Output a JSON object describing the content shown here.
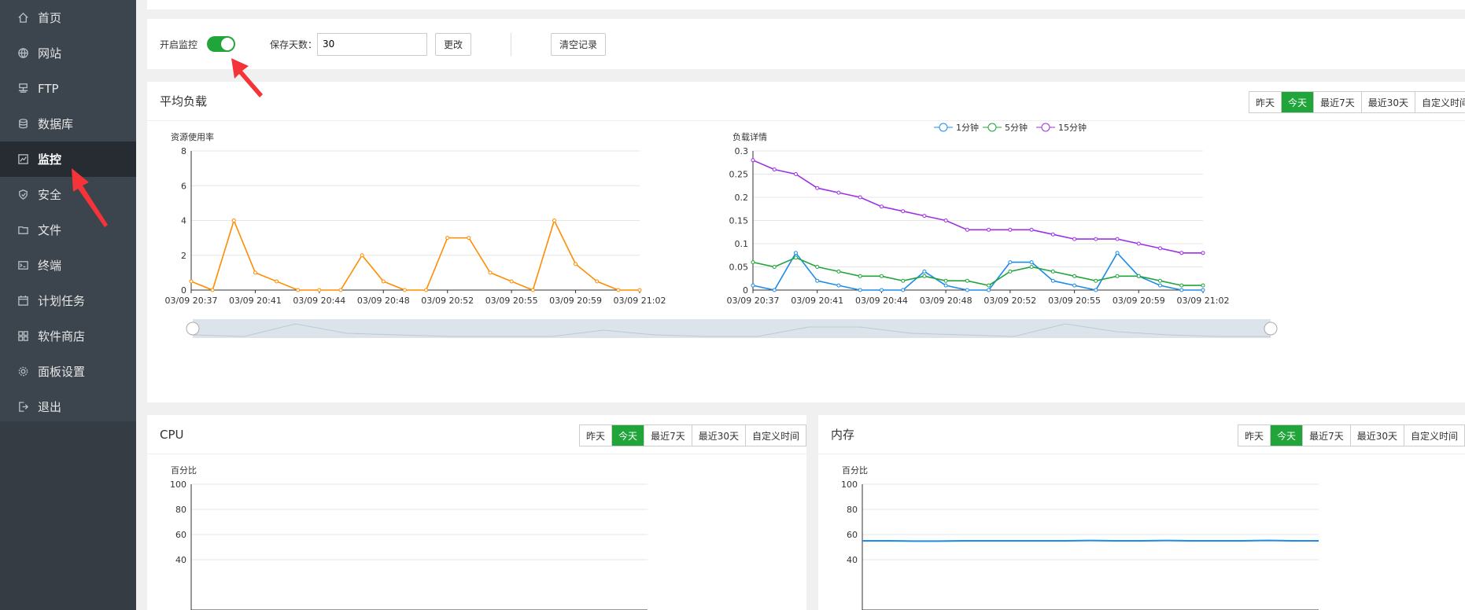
{
  "sidebar": {
    "items": [
      {
        "label": "首页",
        "icon": "home-icon"
      },
      {
        "label": "网站",
        "icon": "globe-icon"
      },
      {
        "label": "FTP",
        "icon": "ftp-icon"
      },
      {
        "label": "数据库",
        "icon": "database-icon"
      },
      {
        "label": "监控",
        "icon": "monitor-icon",
        "active": true
      },
      {
        "label": "安全",
        "icon": "shield-icon"
      },
      {
        "label": "文件",
        "icon": "folder-icon"
      },
      {
        "label": "终端",
        "icon": "terminal-icon"
      },
      {
        "label": "计划任务",
        "icon": "calendar-icon"
      },
      {
        "label": "软件商店",
        "icon": "apps-icon"
      },
      {
        "label": "面板设置",
        "icon": "gear-icon"
      },
      {
        "label": "退出",
        "icon": "logout-icon"
      }
    ]
  },
  "controls": {
    "monitor_label": "开启监控",
    "monitor_on": true,
    "days_label": "保存天数：",
    "days_value": "30",
    "change_button": "更改",
    "clear_button": "清空记录"
  },
  "tabs": [
    "昨天",
    "今天",
    "最近7天",
    "最近30天",
    "自定义时间"
  ],
  "active_tab": "今天",
  "load_card": {
    "title": "平均负载"
  },
  "cpu_card": {
    "title": "CPU"
  },
  "mem_card": {
    "title": "内存"
  },
  "chart_data": [
    {
      "type": "line",
      "ylabel": "资源使用率",
      "ylim": [
        0,
        8
      ],
      "yticks": [
        0,
        2,
        4,
        6,
        8
      ],
      "x": [
        "03/09 20:37",
        "03/09 20:41",
        "03/09 20:44",
        "03/09 20:48",
        "03/09 20:52",
        "03/09 20:55",
        "03/09 20:59",
        "03/09 21:02"
      ],
      "series": [
        {
          "color": "#ff8c00",
          "values": [
            0.5,
            0,
            4,
            1,
            0.5,
            0,
            0,
            0,
            2,
            0.5,
            0,
            0,
            3,
            3,
            1,
            0.5,
            0,
            4,
            1.5,
            0.5,
            0,
            0
          ]
        }
      ],
      "data_zoom": true
    },
    {
      "type": "line",
      "ylabel": "负载详情",
      "ylim": [
        0,
        0.3
      ],
      "yticks": [
        0,
        0.05,
        0.1,
        0.15,
        0.2,
        0.25,
        0.3
      ],
      "x": [
        "03/09 20:37",
        "03/09 20:41",
        "03/09 20:44",
        "03/09 20:48",
        "03/09 20:52",
        "03/09 20:55",
        "03/09 20:59",
        "03/09 21:02"
      ],
      "legend": "top-center",
      "series": [
        {
          "name": "1分钟",
          "color": "#1b8bea",
          "values": [
            0.01,
            0,
            0.08,
            0.02,
            0.01,
            0,
            0,
            0,
            0.04,
            0.01,
            0,
            0,
            0.06,
            0.06,
            0.02,
            0.01,
            0,
            0.08,
            0.03,
            0.01,
            0,
            0
          ]
        },
        {
          "name": "5分钟",
          "color": "#20a53a",
          "values": [
            0.06,
            0.05,
            0.07,
            0.05,
            0.04,
            0.03,
            0.03,
            0.02,
            0.03,
            0.02,
            0.02,
            0.01,
            0.04,
            0.05,
            0.04,
            0.03,
            0.02,
            0.03,
            0.03,
            0.02,
            0.01,
            0.01
          ]
        },
        {
          "name": "15分钟",
          "color": "#9d30e6",
          "values": [
            0.28,
            0.26,
            0.25,
            0.22,
            0.21,
            0.2,
            0.18,
            0.17,
            0.16,
            0.15,
            0.13,
            0.13,
            0.13,
            0.13,
            0.12,
            0.11,
            0.11,
            0.11,
            0.1,
            0.09,
            0.08,
            0.08
          ]
        }
      ]
    },
    {
      "type": "line",
      "ylabel": "百分比",
      "ylim": [
        0,
        100
      ],
      "yticks": [
        40,
        60,
        80,
        100
      ],
      "series": []
    },
    {
      "type": "line",
      "ylabel": "百分比",
      "ylim": [
        0,
        100
      ],
      "yticks": [
        40,
        60,
        80,
        100
      ],
      "series": [
        {
          "color": "#1b8bea",
          "values": [
            55,
            55,
            54.8,
            54.8,
            55,
            55,
            55,
            55,
            55,
            55.2,
            55,
            55,
            55.2,
            55,
            55,
            55,
            55.3,
            55,
            55
          ]
        }
      ]
    }
  ]
}
